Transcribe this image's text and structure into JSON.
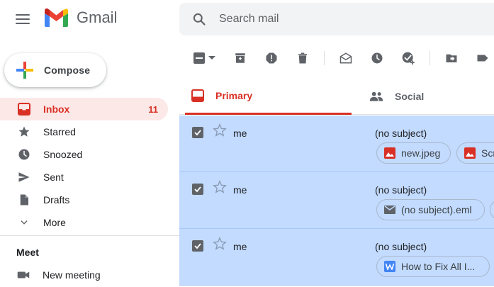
{
  "app": {
    "name": "Gmail"
  },
  "search": {
    "placeholder": "Search mail"
  },
  "compose": {
    "label": "Compose"
  },
  "sidebar": {
    "items": [
      {
        "label": "Inbox",
        "count": "11",
        "active": true
      },
      {
        "label": "Starred"
      },
      {
        "label": "Snoozed"
      },
      {
        "label": "Sent"
      },
      {
        "label": "Drafts"
      },
      {
        "label": "More"
      }
    ],
    "meet": {
      "title": "Meet",
      "new_meeting": "New meeting"
    }
  },
  "tabs": [
    {
      "label": "Primary",
      "active": true
    },
    {
      "label": "Social"
    }
  ],
  "emails": [
    {
      "sender": "me",
      "subject": "(no subject)",
      "attachments": [
        {
          "label": "new.jpeg",
          "icon": "image-icon"
        },
        {
          "label": "Scr",
          "icon": "image-icon"
        }
      ]
    },
    {
      "sender": "me",
      "subject": "(no subject)",
      "attachments": [
        {
          "label": "(no subject).eml",
          "icon": "mail-icon"
        }
      ]
    },
    {
      "sender": "me",
      "subject": "(no subject)",
      "attachments": [
        {
          "label": "How to Fix All I...",
          "icon": "word-doc-icon"
        }
      ]
    }
  ],
  "colors": {
    "accent": "#d93025",
    "selected_row": "#c2dbff",
    "active_nav": "#fce8e6"
  }
}
